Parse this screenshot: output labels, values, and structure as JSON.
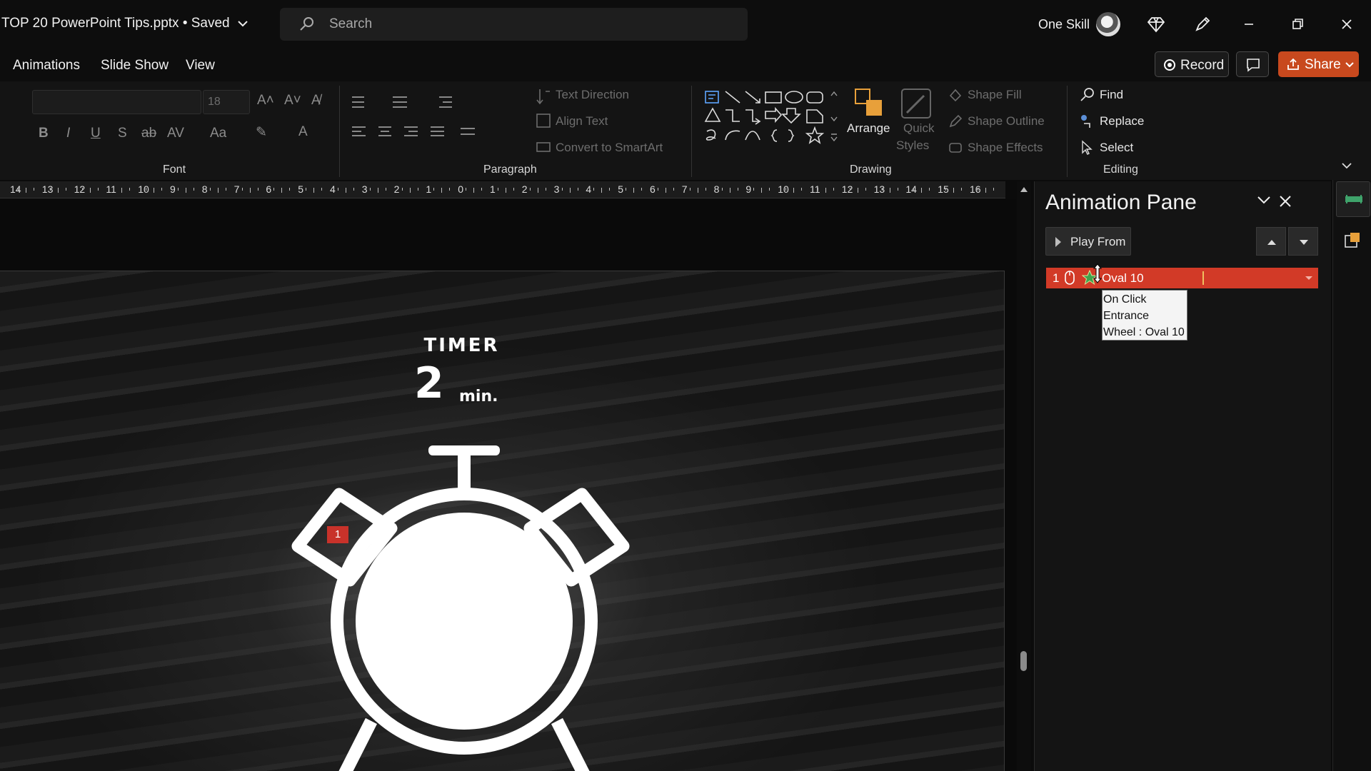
{
  "titlebar": {
    "doc_title": "TOP 20 PowerPoint Tips.pptx • Saved",
    "search_placeholder": "Search",
    "account_name": "One Skill"
  },
  "tabs": [
    "Animations",
    "Slide Show",
    "View"
  ],
  "actions": {
    "record": "Record",
    "share": "Share"
  },
  "ribbon": {
    "font": {
      "group_label": "Font",
      "font_name": "",
      "font_size": "18",
      "buttons": [
        "B",
        "I",
        "U",
        "S",
        "ab",
        "AV",
        "Aa",
        "A"
      ]
    },
    "paragraph": {
      "group_label": "Paragraph",
      "text_direction": "Text Direction",
      "align_text": "Align Text",
      "convert_smartart": "Convert to SmartArt"
    },
    "drawing": {
      "group_label": "Drawing",
      "arrange": "Arrange",
      "quick_styles_1": "Quick",
      "quick_styles_2": "Styles",
      "shape_fill": "Shape Fill",
      "shape_outline": "Shape Outline",
      "shape_effects": "Shape Effects"
    },
    "editing": {
      "group_label": "Editing",
      "find": "Find",
      "replace": "Replace",
      "select": "Select"
    }
  },
  "ruler_numbers": [
    "14",
    "13",
    "12",
    "11",
    "10",
    "9",
    "8",
    "7",
    "6",
    "5",
    "4",
    "3",
    "2",
    "1",
    "0",
    "1",
    "2",
    "3",
    "4",
    "5",
    "6",
    "7",
    "8",
    "9",
    "10",
    "11",
    "12",
    "13",
    "14",
    "15",
    "16"
  ],
  "slide": {
    "title": "TIMER",
    "number": "2",
    "unit": "min.",
    "animation_tag": "1"
  },
  "animation_pane": {
    "title": "Animation Pane",
    "play_from": "Play From",
    "item": {
      "order": "1",
      "label": "Oval 10"
    },
    "tooltip": [
      "On Click",
      "Entrance",
      "Wheel : Oval 10"
    ]
  },
  "colors": {
    "accent_orange": "#c8491e",
    "anim_red": "#d23a27",
    "bg": "#0b0b0b"
  }
}
